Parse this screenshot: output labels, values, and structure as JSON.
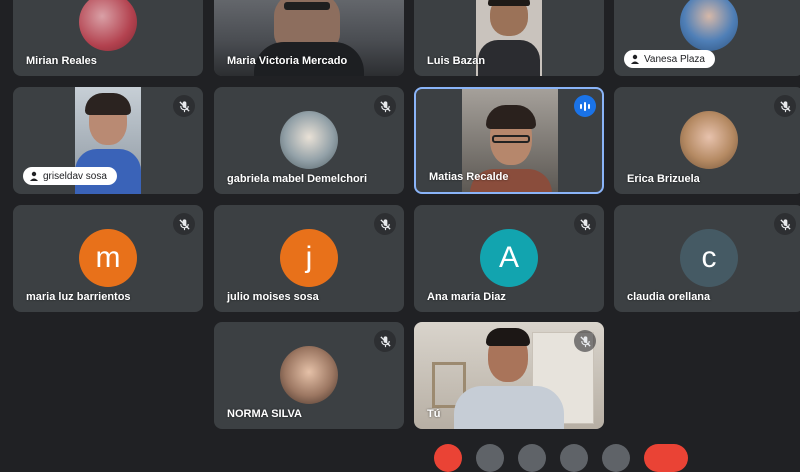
{
  "participants": [
    {
      "name": "Mirian Reales"
    },
    {
      "name": "Maria Victoria Mercado"
    },
    {
      "name": "Luis Bazan"
    },
    {
      "name": "Vanesa Plaza"
    },
    {
      "name": "griseldav sosa"
    },
    {
      "name": "gabriela mabel Demelchori"
    },
    {
      "name": "Matias Recalde"
    },
    {
      "name": "Erica Brizuela"
    },
    {
      "name": "maria luz barrientos",
      "initial": "m",
      "color": "#e8711a"
    },
    {
      "name": "julio moises sosa",
      "initial": "j",
      "color": "#e8711a"
    },
    {
      "name": "Ana maria Diaz",
      "initial": "A",
      "color": "#12a4af"
    },
    {
      "name": "claudia orellana",
      "initial": "c",
      "color": "#455a64"
    },
    {
      "name": "NORMA SILVA"
    },
    {
      "name": "Tú"
    }
  ],
  "icons": {
    "muted": "mic-off-icon",
    "speaking": "audio-level-icon",
    "person": "person-icon"
  }
}
